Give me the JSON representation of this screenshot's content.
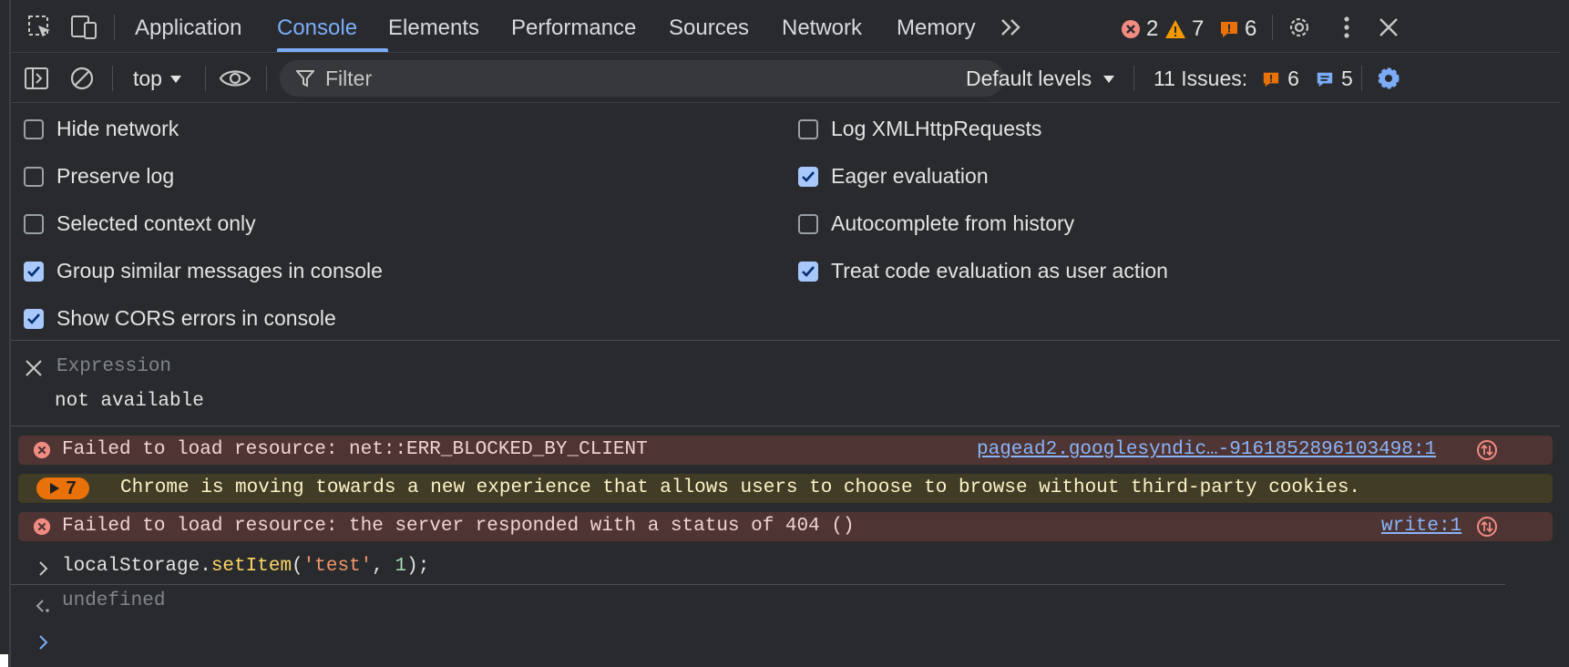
{
  "tabs": [
    {
      "label": "Application"
    },
    {
      "label": "Console"
    },
    {
      "label": "Elements"
    },
    {
      "label": "Performance"
    },
    {
      "label": "Sources"
    },
    {
      "label": "Network"
    },
    {
      "label": "Memory"
    }
  ],
  "counters": {
    "errors": "2",
    "warnings": "7",
    "issues": "6"
  },
  "toolbar": {
    "context": "top",
    "filter_placeholder": "Filter",
    "levels": "Default levels",
    "issues_label": "11 Issues:",
    "issues_warn": "6",
    "issues_info": "5"
  },
  "settings": {
    "left": [
      {
        "label": "Hide network",
        "checked": false
      },
      {
        "label": "Preserve log",
        "checked": false
      },
      {
        "label": "Selected context only",
        "checked": false
      },
      {
        "label": "Group similar messages in console",
        "checked": true
      },
      {
        "label": "Show CORS errors in console",
        "checked": true
      }
    ],
    "right": [
      {
        "label": "Log XMLHttpRequests",
        "checked": false
      },
      {
        "label": "Eager evaluation",
        "checked": true
      },
      {
        "label": "Autocomplete from history",
        "checked": false
      },
      {
        "label": "Treat code evaluation as user action",
        "checked": true
      }
    ]
  },
  "live_expression": {
    "placeholder": "Expression",
    "value": "not available"
  },
  "messages": [
    {
      "type": "error",
      "text": "Failed to load resource: net::ERR_BLOCKED_BY_CLIENT",
      "source": "pagead2.googlesyndic…-9161852896103498:1"
    },
    {
      "type": "warning",
      "count": "7",
      "text": "Chrome is moving towards a new experience that allows users to choose to browse without third-party cookies."
    },
    {
      "type": "error",
      "text": "Failed to load resource: the server responded with a status of 404 ()",
      "source": "write:1"
    }
  ],
  "repl": {
    "input_obj": "localStorage.",
    "input_fn": "setItem",
    "input_open": "(",
    "input_str": "'test'",
    "input_sep": ", ",
    "input_num": "1",
    "input_close": ");",
    "result": "undefined"
  },
  "colors": {
    "accent": "#7cacf8",
    "error": "#f28b82",
    "warning": "#f29900"
  }
}
